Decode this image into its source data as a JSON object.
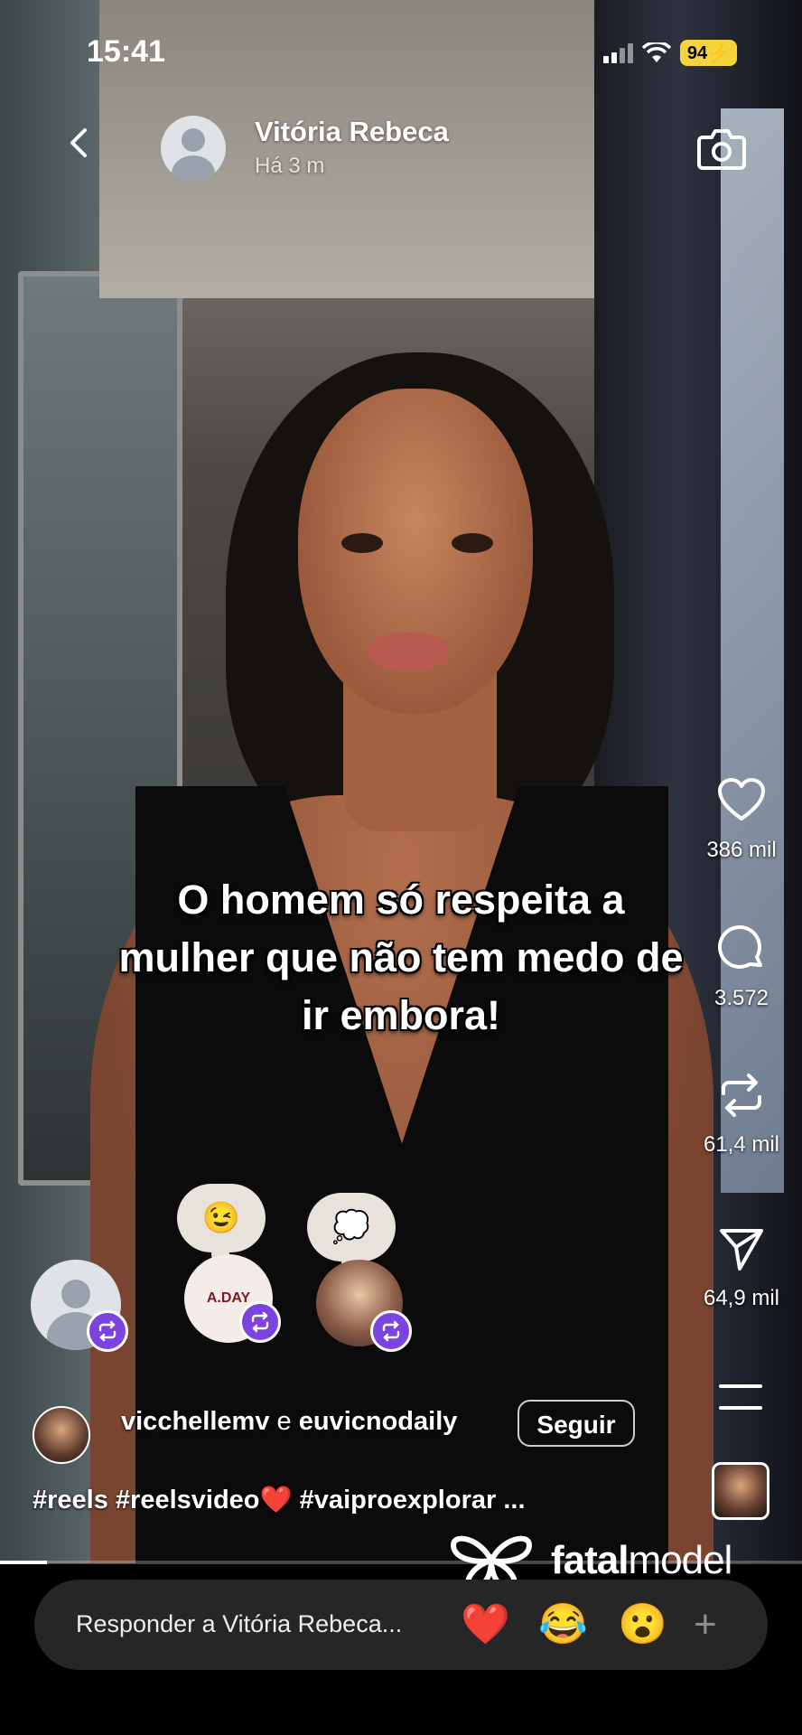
{
  "status_bar": {
    "time": "15:41",
    "battery": "94"
  },
  "header": {
    "username": "Vitória Rebeca",
    "time_ago": "Há 3 m"
  },
  "caption": "O homem só respeita a mulher que não tem medo de ir embora!",
  "actions": {
    "likes": "386 mil",
    "comments": "3.572",
    "reposts": "61,4 mil",
    "shares": "64,9 mil"
  },
  "viewers": [
    {
      "icon": "default-avatar"
    },
    {
      "reaction": "😉",
      "logo_text": "A.DAY"
    },
    {
      "reaction": "💭"
    }
  ],
  "collab": {
    "user1": "vicchellemv",
    "connector": "e",
    "user2": "euvicnodaily",
    "follow_label": "Seguir"
  },
  "hashtags": "#reels #reelsvideo❤️ #vaiproexplorar ...",
  "watermark": {
    "brand_bold": "fatal",
    "brand_rest": "model"
  },
  "reply": {
    "placeholder": "Responder a Vitória Rebeca...",
    "quick_reactions": [
      "❤️",
      "😂",
      "😮"
    ],
    "plus": "+"
  },
  "colors": {
    "repost_badge": "#7b43e0",
    "battery": "#f5d33c"
  }
}
